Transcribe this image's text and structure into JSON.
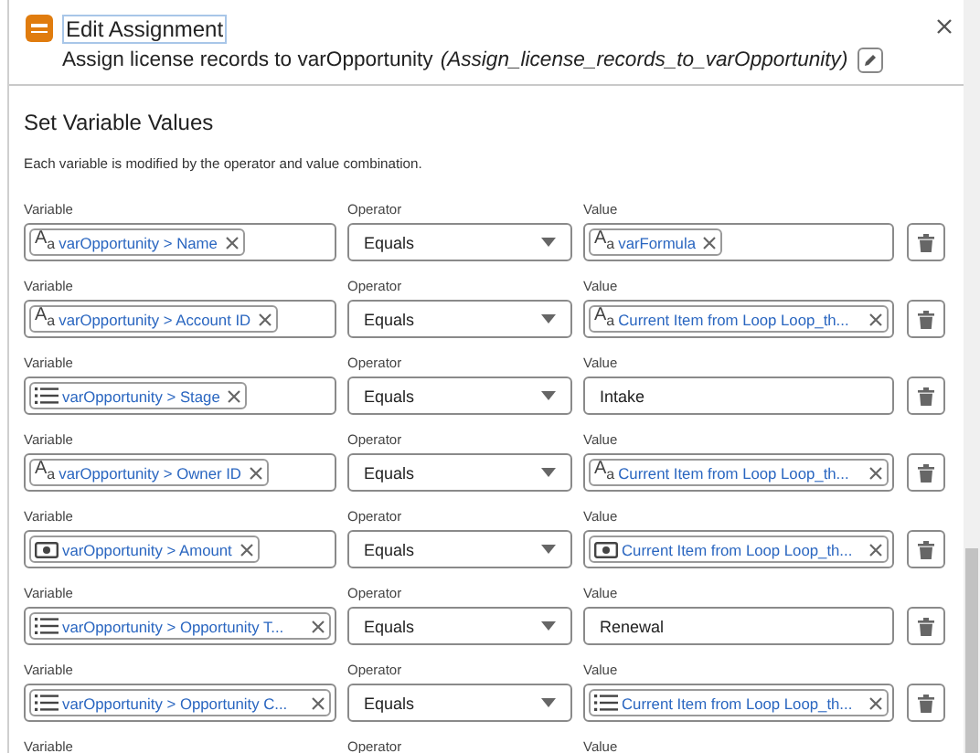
{
  "header": {
    "title": "Edit Assignment",
    "label": "Assign license records to varOpportunity",
    "api_name": "(Assign_license_records_to_varOpportunity)"
  },
  "section": {
    "title": "Set Variable Values",
    "description": "Each variable is modified by the operator and value combination."
  },
  "rows": [
    {
      "variable_label": "Variable",
      "operator_label": "Operator",
      "value_label": "Value",
      "variable": {
        "kind": "text",
        "icon_text": "A$_{a}$",
        "label": "varOpportunity > Name"
      },
      "operator": "Equals",
      "value": {
        "kind": "text",
        "icon_text": "A$_{a}$",
        "label": "varFormula"
      }
    },
    {
      "variable_label": "Variable",
      "operator_label": "Operator",
      "value_label": "Value",
      "variable": {
        "kind": "text",
        "icon_text": "A$_{a}$",
        "label": "varOpportunity > Account ID"
      },
      "operator": "Equals",
      "value": {
        "kind": "text",
        "icon_text": "A$_{a}$",
        "label": "Current Item from Loop Loop_th..."
      }
    },
    {
      "variable_label": "Variable",
      "operator_label": "Operator",
      "value_label": "Value",
      "variable": {
        "kind": "picklist",
        "label": "varOpportunity > Stage"
      },
      "operator": "Equals",
      "value": {
        "kind": "literal",
        "label": "Intake"
      }
    },
    {
      "variable_label": "Variable",
      "operator_label": "Operator",
      "value_label": "Value",
      "variable": {
        "kind": "text",
        "icon_text": "A$_{a}$",
        "label": "varOpportunity > Owner ID"
      },
      "operator": "Equals",
      "value": {
        "kind": "text",
        "icon_text": "A$_{a}$",
        "label": "Current Item from Loop Loop_th..."
      }
    },
    {
      "variable_label": "Variable",
      "operator_label": "Operator",
      "value_label": "Value",
      "variable": {
        "kind": "currency",
        "label": "varOpportunity > Amount"
      },
      "operator": "Equals",
      "value": {
        "kind": "currency",
        "label": "Current Item from Loop Loop_th..."
      }
    },
    {
      "variable_label": "Variable",
      "operator_label": "Operator",
      "value_label": "Value",
      "variable": {
        "kind": "picklist",
        "label": "varOpportunity > Opportunity T..."
      },
      "operator": "Equals",
      "value": {
        "kind": "literal",
        "label": "Renewal"
      }
    },
    {
      "variable_label": "Variable",
      "operator_label": "Operator",
      "value_label": "Value",
      "variable": {
        "kind": "picklist",
        "label": "varOpportunity > Opportunity C..."
      },
      "operator": "Equals",
      "value": {
        "kind": "picklist",
        "label": "Current Item from Loop Loop_th..."
      }
    },
    {
      "variable_label": "Variable",
      "operator_label": "Operator",
      "value_label": "Value"
    }
  ]
}
